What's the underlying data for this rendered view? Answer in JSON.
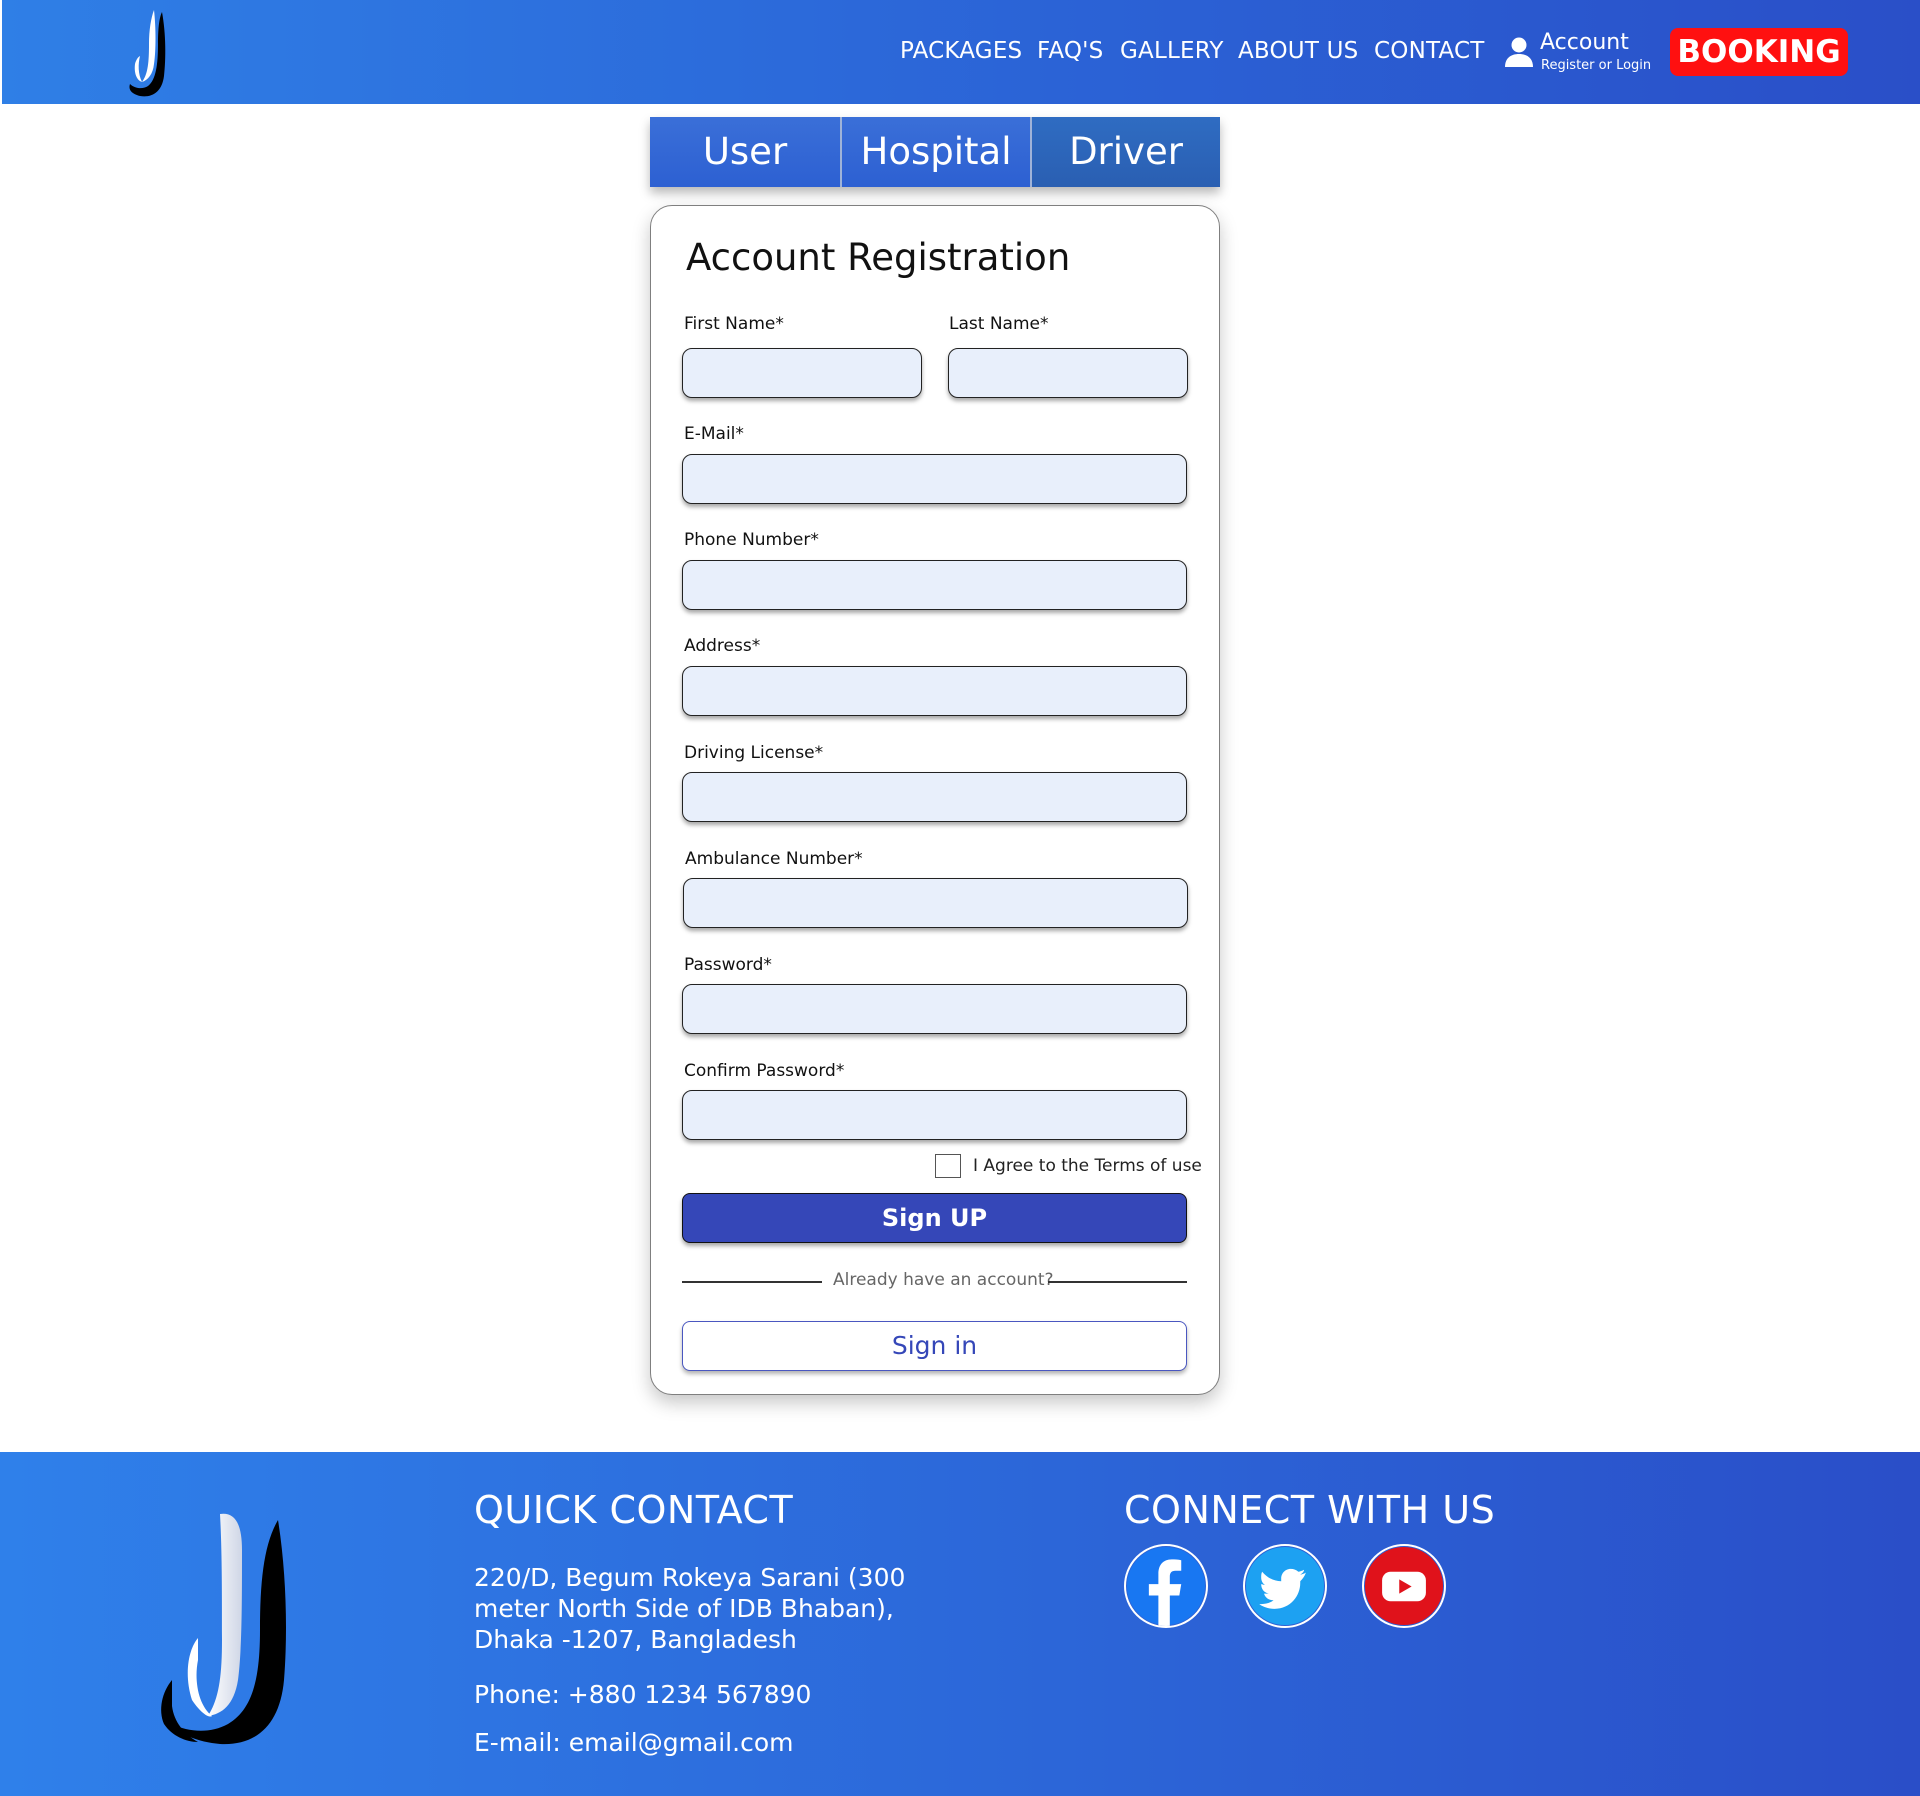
{
  "header": {
    "nav": [
      "PACKAGES",
      "FAQ'S",
      "GALLERY",
      "ABOUT US",
      "CONTACT"
    ],
    "account_title": "Account",
    "account_subtitle": "Register or Login",
    "booking_label": "BOOKING"
  },
  "tabs": [
    "User",
    "Hospital",
    "Driver"
  ],
  "active_tab": "Driver",
  "form": {
    "title": "Account Registration",
    "first_name_label": "First Name*",
    "last_name_label": "Last Name*",
    "email_label": "E-Mail*",
    "phone_label": "Phone Number*",
    "address_label": "Address*",
    "license_label": "Driving License*",
    "ambulance_label": "Ambulance Number*",
    "password_label": "Password*",
    "confirm_password_label": "Confirm Password*",
    "agree_label": "I Agree to the Terms of use",
    "signup_label": "Sign UP",
    "divider_text": "Already have an account?",
    "signin_label": "Sign in"
  },
  "footer": {
    "quick_contact_heading": "QUICK CONTACT",
    "address": "220/D, Begum Rokeya Sarani (300 meter North Side of IDB Bhaban), Dhaka -1207, Bangladesh",
    "phone": "Phone: +880 1234 567890",
    "email": "E-mail: email@gmail.com",
    "connect_heading": "CONNECT WITH US",
    "social": [
      {
        "icon": "facebook-icon",
        "color": "#1877f2"
      },
      {
        "icon": "twitter-icon",
        "color": "#1da1f2"
      },
      {
        "icon": "youtube-icon",
        "color": "#e0121b"
      }
    ]
  },
  "colors": {
    "header_gradient_start": "#2f7fe6",
    "header_gradient_end": "#2a4fc8",
    "booking": "#ff1010",
    "signup": "#3547b8",
    "input_fill": "#e8effb"
  }
}
